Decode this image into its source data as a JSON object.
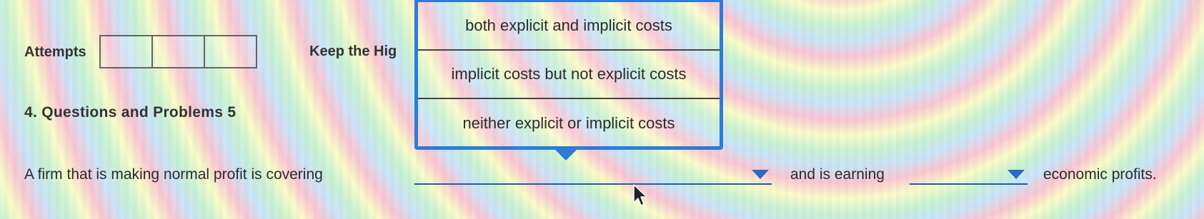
{
  "attempts": {
    "label": "Attempts",
    "box_count": 3
  },
  "keep_highest": {
    "label": "Keep the Hig"
  },
  "question": {
    "title": "4. Questions and Problems 5",
    "sentence_part1": "A firm that is making normal profit is covering",
    "sentence_part2": "and is earning",
    "sentence_part3": "economic profits."
  },
  "dropdown_1": {
    "selected": "",
    "expanded": true,
    "options": [
      "both explicit and implicit costs",
      "implicit costs but not explicit costs",
      "neither explicit or implicit costs"
    ]
  },
  "dropdown_2": {
    "selected": "",
    "expanded": false
  },
  "colors": {
    "accent": "#2e7cd6",
    "text": "#2b2b2b"
  },
  "icons": {
    "dropdown_caret": "caret-down-icon",
    "cursor": "mouse-pointer-icon"
  }
}
